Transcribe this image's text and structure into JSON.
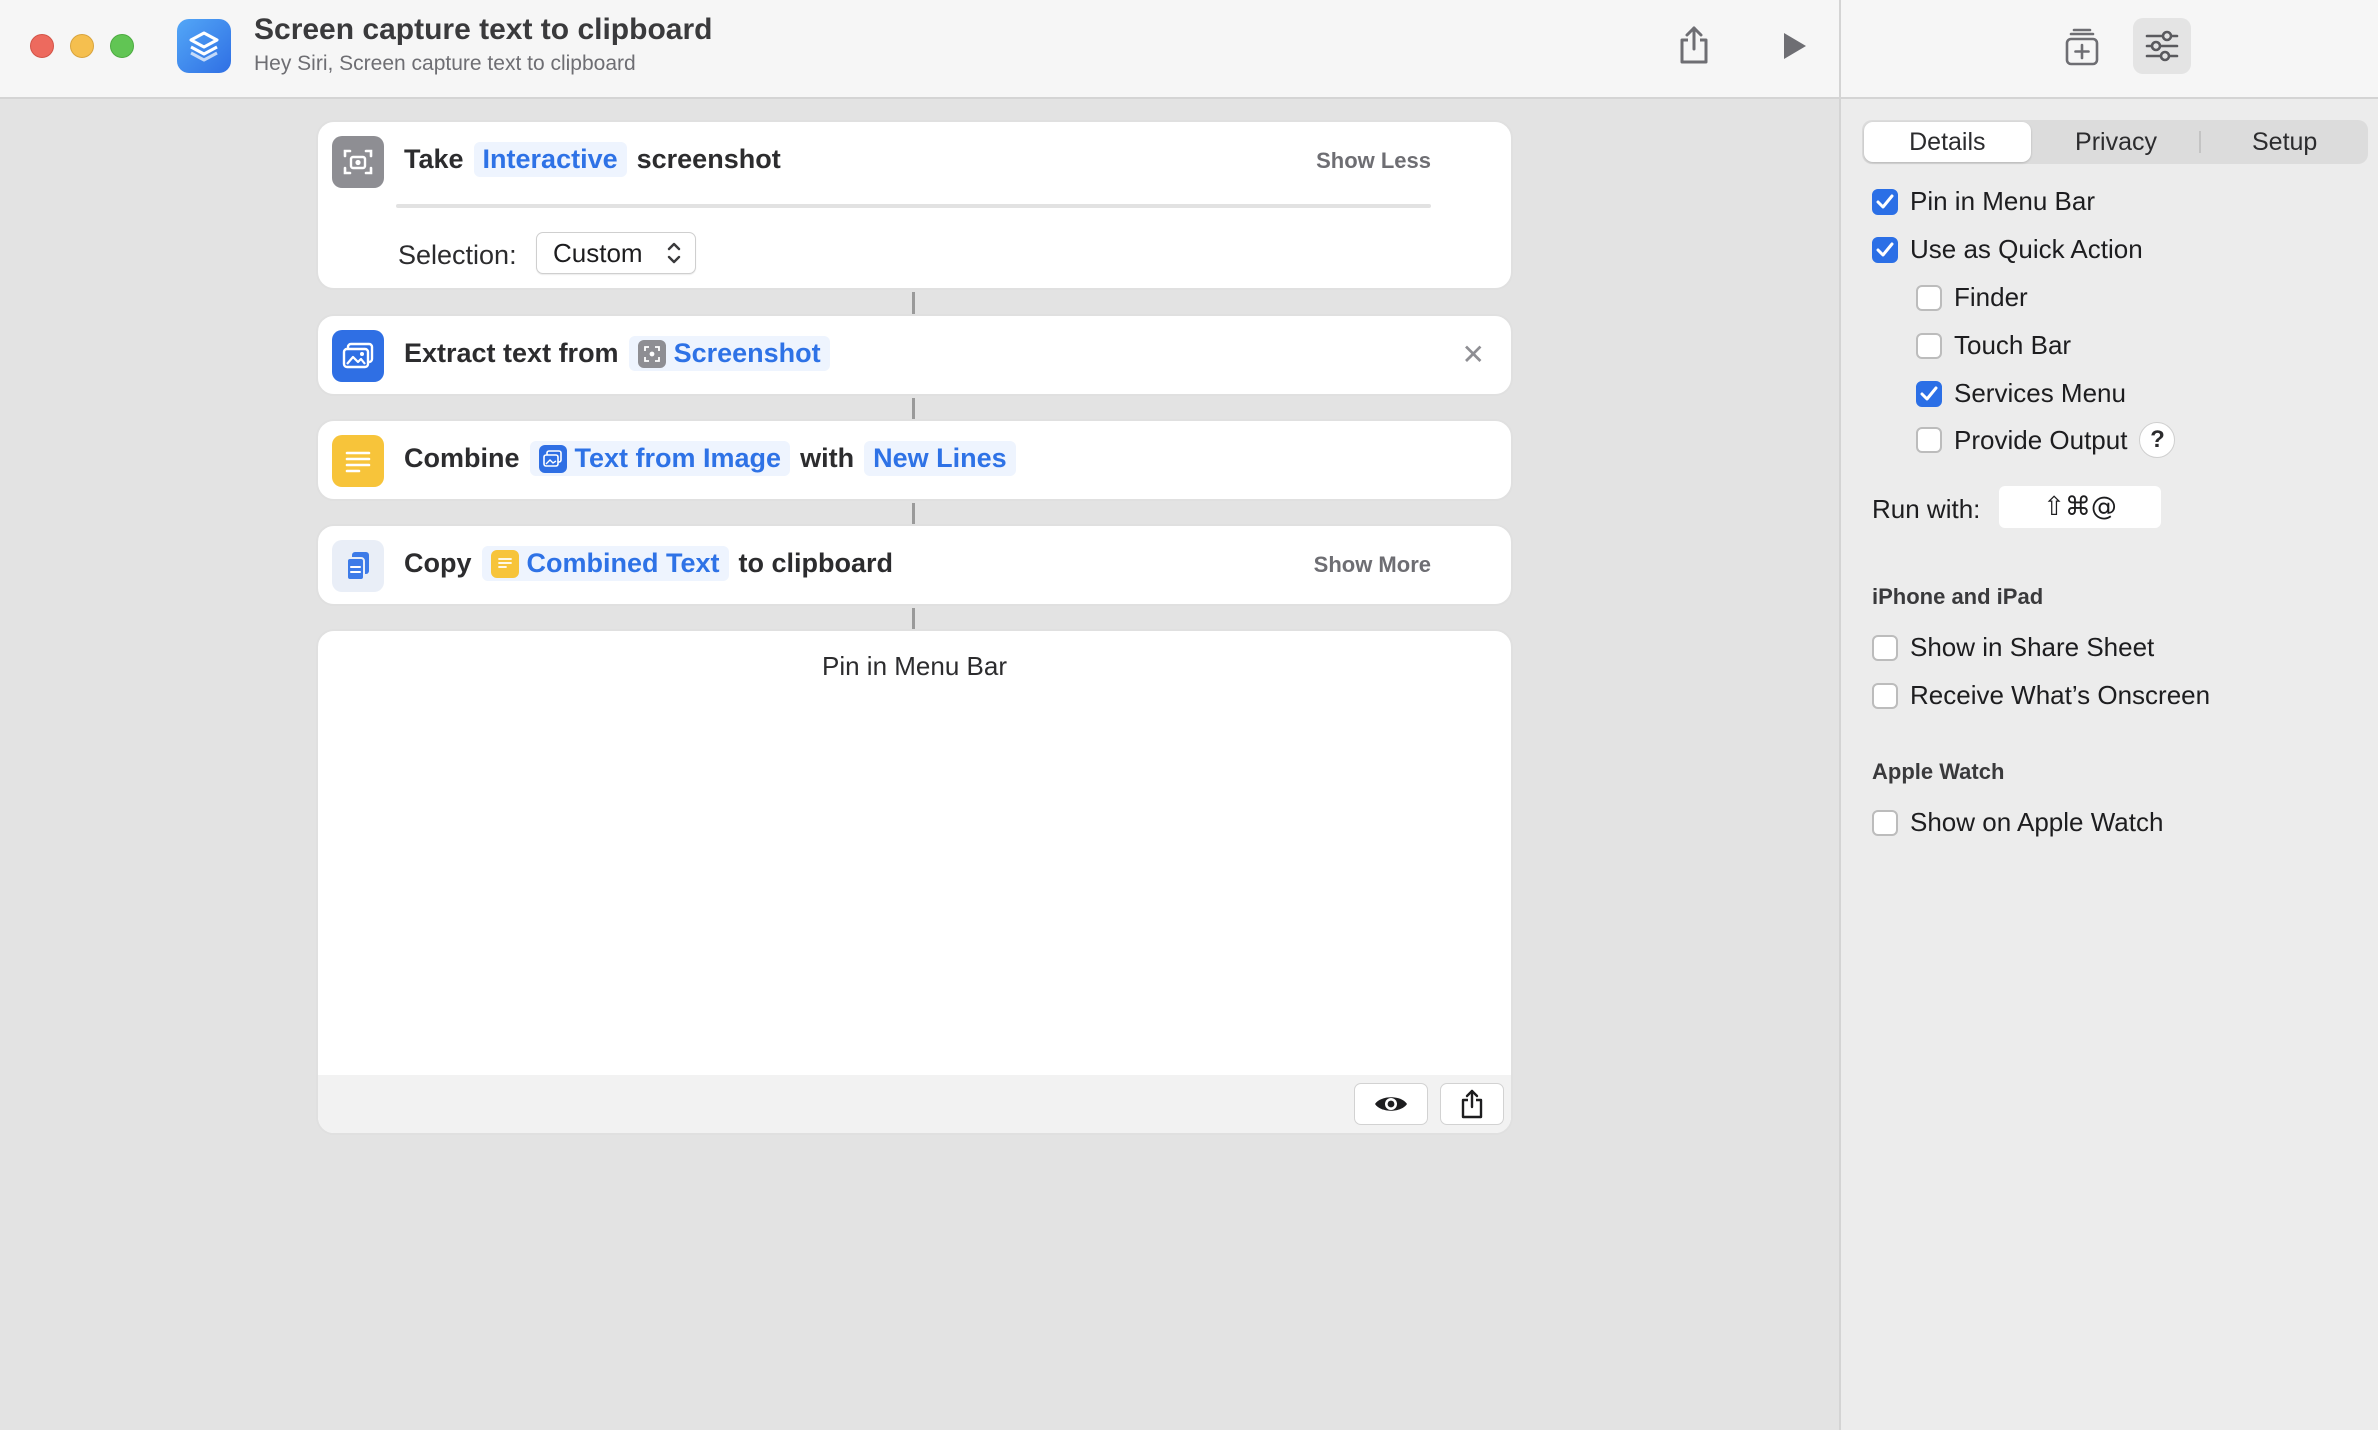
{
  "window": {
    "title": "Screen capture text to clipboard",
    "subtitle": "Hey Siri, Screen capture text to clipboard"
  },
  "actions": [
    {
      "verb": "Take",
      "token": "Interactive",
      "suffix": "screenshot",
      "toggle": "Show Less",
      "selection_label": "Selection:",
      "selection_value": "Custom",
      "icon": "screenshot-icon"
    },
    {
      "verb": "Extract text from",
      "token": "Screenshot",
      "icon": "image-text-icon"
    },
    {
      "verb": "Combine",
      "token": "Text from Image",
      "middle": "with",
      "token2": "New Lines",
      "icon": "text-lines-icon"
    },
    {
      "verb": "Copy",
      "token": "Combined Text",
      "suffix": "to clipboard",
      "toggle": "Show More",
      "icon": "clipboard-icon"
    }
  ],
  "preview": {
    "title": "Pin in Menu Bar"
  },
  "sidebar": {
    "tabs": [
      "Details",
      "Privacy",
      "Setup"
    ],
    "active_tab": "Details",
    "options": [
      {
        "label": "Pin in Menu Bar",
        "checked": true
      },
      {
        "label": "Use as Quick Action",
        "checked": true
      },
      {
        "label": "Finder",
        "checked": false
      },
      {
        "label": "Touch Bar",
        "checked": false
      },
      {
        "label": "Services Menu",
        "checked": true
      },
      {
        "label": "Provide Output",
        "checked": false
      }
    ],
    "help": "?",
    "run_with_label": "Run with:",
    "run_with_value": "⇧⌘@",
    "iphone_section": "iPhone and iPad",
    "iphone_options": [
      {
        "label": "Show in Share Sheet",
        "checked": false
      },
      {
        "label": "Receive What’s Onscreen",
        "checked": false
      }
    ],
    "watch_section": "Apple Watch",
    "watch_options": [
      {
        "label": "Show on Apple Watch",
        "checked": false
      }
    ]
  },
  "colors": {
    "accent": "#2b6fe6",
    "token_text": "#2e72e6",
    "token_bg": "#eef4fe",
    "screenshot_gray": "#8e8e93",
    "image_blue": "#2f6fe4",
    "text_yellow": "#f7c43a",
    "clipboard_blue": "#3d7be8"
  }
}
